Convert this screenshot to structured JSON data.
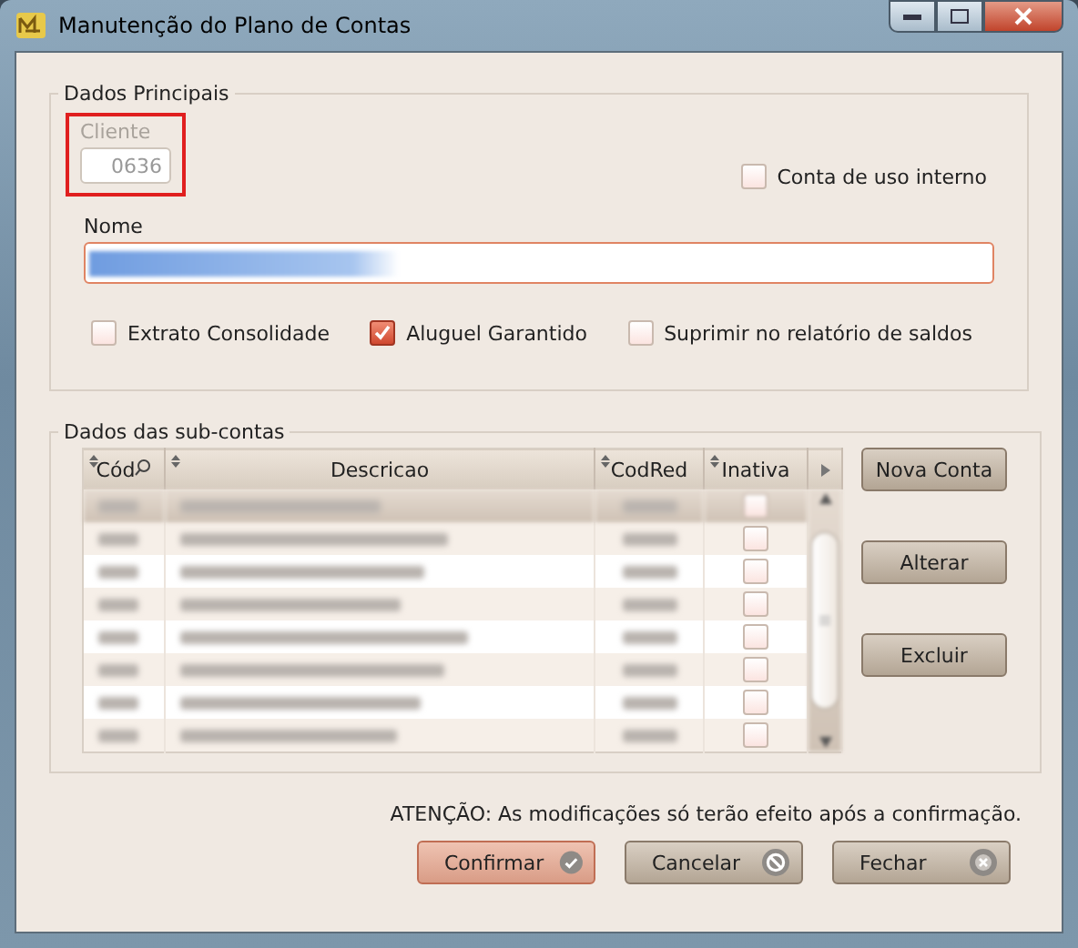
{
  "window": {
    "title": "Manutenção do Plano de Contas"
  },
  "main": {
    "title": "Dados Principais",
    "cliente": {
      "label": "Cliente",
      "value": "0636",
      "disabled": true
    },
    "internal": {
      "label": "Conta de uso interno",
      "checked": false
    },
    "nome": {
      "label": "Nome"
    },
    "options": [
      {
        "label": "Extrato Consolidade",
        "checked": false
      },
      {
        "label": "Aluguel Garantido",
        "checked": true
      },
      {
        "label": "Suprimir no relatório de saldos",
        "checked": false
      }
    ]
  },
  "sub": {
    "title": "Dados das sub-contas",
    "columns": [
      "Cód",
      "Descricao",
      "CodRed",
      "Inativa"
    ],
    "rows": [
      {
        "selected": true,
        "inativa": false
      },
      {
        "selected": false,
        "inativa": false
      },
      {
        "selected": false,
        "inativa": false
      },
      {
        "selected": false,
        "inativa": false
      },
      {
        "selected": false,
        "inativa": false
      },
      {
        "selected": false,
        "inativa": false
      },
      {
        "selected": false,
        "inativa": false
      },
      {
        "selected": false,
        "inativa": false
      }
    ],
    "buttons": [
      "Nova Conta",
      "Alterar",
      "Excluir"
    ]
  },
  "notice": "ATENÇÃO: As modificações só terão efeito após a confirmação.",
  "footer": [
    {
      "label": "Confirmar",
      "kind": "confirm",
      "default": true
    },
    {
      "label": "Cancelar",
      "kind": "cancel",
      "default": false
    },
    {
      "label": "Fechar",
      "kind": "close",
      "default": false
    }
  ]
}
